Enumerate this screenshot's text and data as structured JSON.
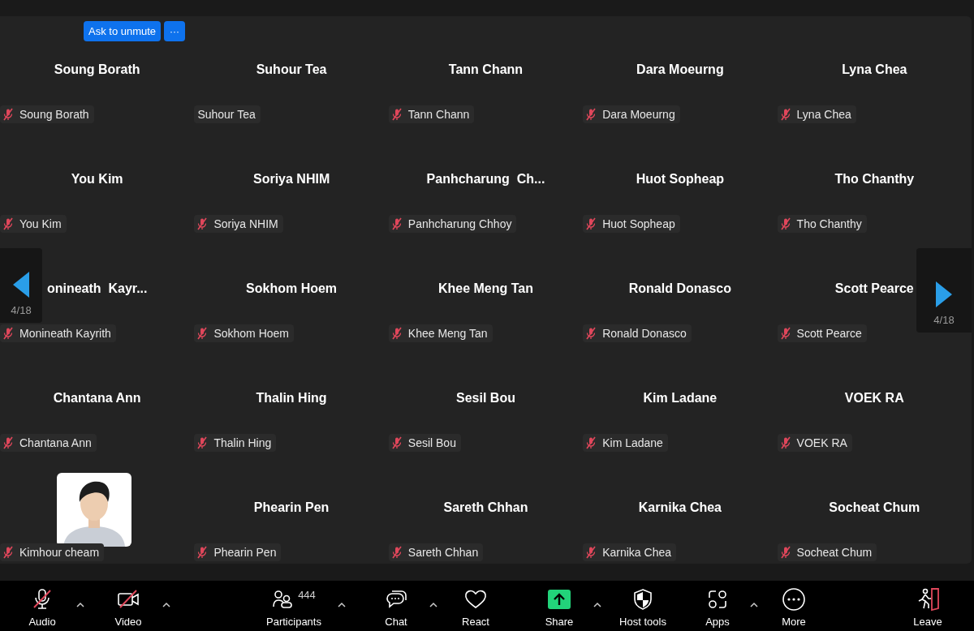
{
  "unmute_bar": {
    "button": "Ask to unmute",
    "more": "···"
  },
  "tiles": [
    {
      "kind": "name",
      "title": "Soung Borath",
      "label": "Soung Borath",
      "muted": true
    },
    {
      "kind": "name",
      "title": "Suhour Tea",
      "label": "Suhour Tea",
      "muted": false
    },
    {
      "kind": "name",
      "title": "Tann Chann",
      "label": "Tann Chann",
      "muted": true
    },
    {
      "kind": "name",
      "title": "Dara Moeurng",
      "label": "Dara Moeurng",
      "muted": true
    },
    {
      "kind": "name",
      "title": "Lyna Chea",
      "label": "Lyna Chea",
      "muted": true
    },
    {
      "kind": "name",
      "title": "You Kim",
      "label": "You Kim",
      "muted": true
    },
    {
      "kind": "name",
      "title": "Soriya NHIM",
      "label": "Soriya NHIM",
      "muted": true
    },
    {
      "kind": "name",
      "title": "Panhcharung  Ch...",
      "label": "Panhcharung Chhoy",
      "muted": true
    },
    {
      "kind": "name",
      "title": "Huot Sopheap",
      "label": "Huot Sopheap",
      "muted": true
    },
    {
      "kind": "name",
      "title": "Tho Chanthy",
      "label": "Tho Chanthy",
      "muted": true
    },
    {
      "kind": "name",
      "title": "onineath  Kayr...",
      "label": "Monineath Kayrith",
      "muted": true
    },
    {
      "kind": "name",
      "title": "Sokhom Hoem",
      "label": "Sokhom Hoem",
      "muted": true
    },
    {
      "kind": "name",
      "title": "Khee Meng Tan",
      "label": "Khee Meng Tan",
      "muted": true
    },
    {
      "kind": "name",
      "title": "Ronald Donasco",
      "label": "Ronald Donasco",
      "muted": true
    },
    {
      "kind": "name",
      "title": "Scott Pearce",
      "label": "Scott Pearce",
      "muted": true
    },
    {
      "kind": "name",
      "title": "Chantana Ann",
      "label": "Chantana Ann",
      "muted": true
    },
    {
      "kind": "name",
      "title": "Thalin Hing",
      "label": "Thalin Hing",
      "muted": true
    },
    {
      "kind": "name",
      "title": "Sesil Bou",
      "label": "Sesil Bou",
      "muted": true
    },
    {
      "kind": "name",
      "title": "Kim Ladane",
      "label": "Kim Ladane",
      "muted": true
    },
    {
      "kind": "name",
      "title": "VOEK RA",
      "label": "VOEK RA",
      "muted": true
    },
    {
      "label": "Kimhour cheam",
      "muted": true
    },
    {
      "kind": "name",
      "title": "Phearin Pen",
      "label": "Phearin Pen",
      "muted": true
    },
    {
      "kind": "name",
      "title": "Sareth Chhan",
      "label": "Sareth Chhan",
      "muted": true
    },
    {
      "kind": "name",
      "title": "Karnika Chea",
      "label": "Karnika Chea",
      "muted": true
    },
    {
      "kind": "name",
      "title": "Socheat Chum",
      "label": "Socheat Chum",
      "muted": true
    }
  ],
  "pager": {
    "previous": "4/18",
    "next": "4/18"
  },
  "toolbar": [
    {
      "kind": "audio",
      "label": "Audio",
      "off": true,
      "caret": true
    },
    {
      "kind": "video",
      "label": "Video",
      "off": true,
      "caret": true
    },
    {
      "kind": "participants",
      "label": "Participants",
      "count": "444",
      "caret": true
    },
    {
      "kind": "chat",
      "label": "Chat",
      "caret": true
    },
    {
      "kind": "react",
      "label": "React",
      "caret": false
    },
    {
      "kind": "share",
      "label": "Share",
      "caret": true
    },
    {
      "kind": "host",
      "label": "Host tools",
      "caret": false
    },
    {
      "kind": "apps",
      "label": "Apps",
      "caret": true
    },
    {
      "kind": "more",
      "label": "More",
      "caret": false
    },
    {
      "kind": "leave",
      "label": "Leave",
      "caret": false
    }
  ]
}
